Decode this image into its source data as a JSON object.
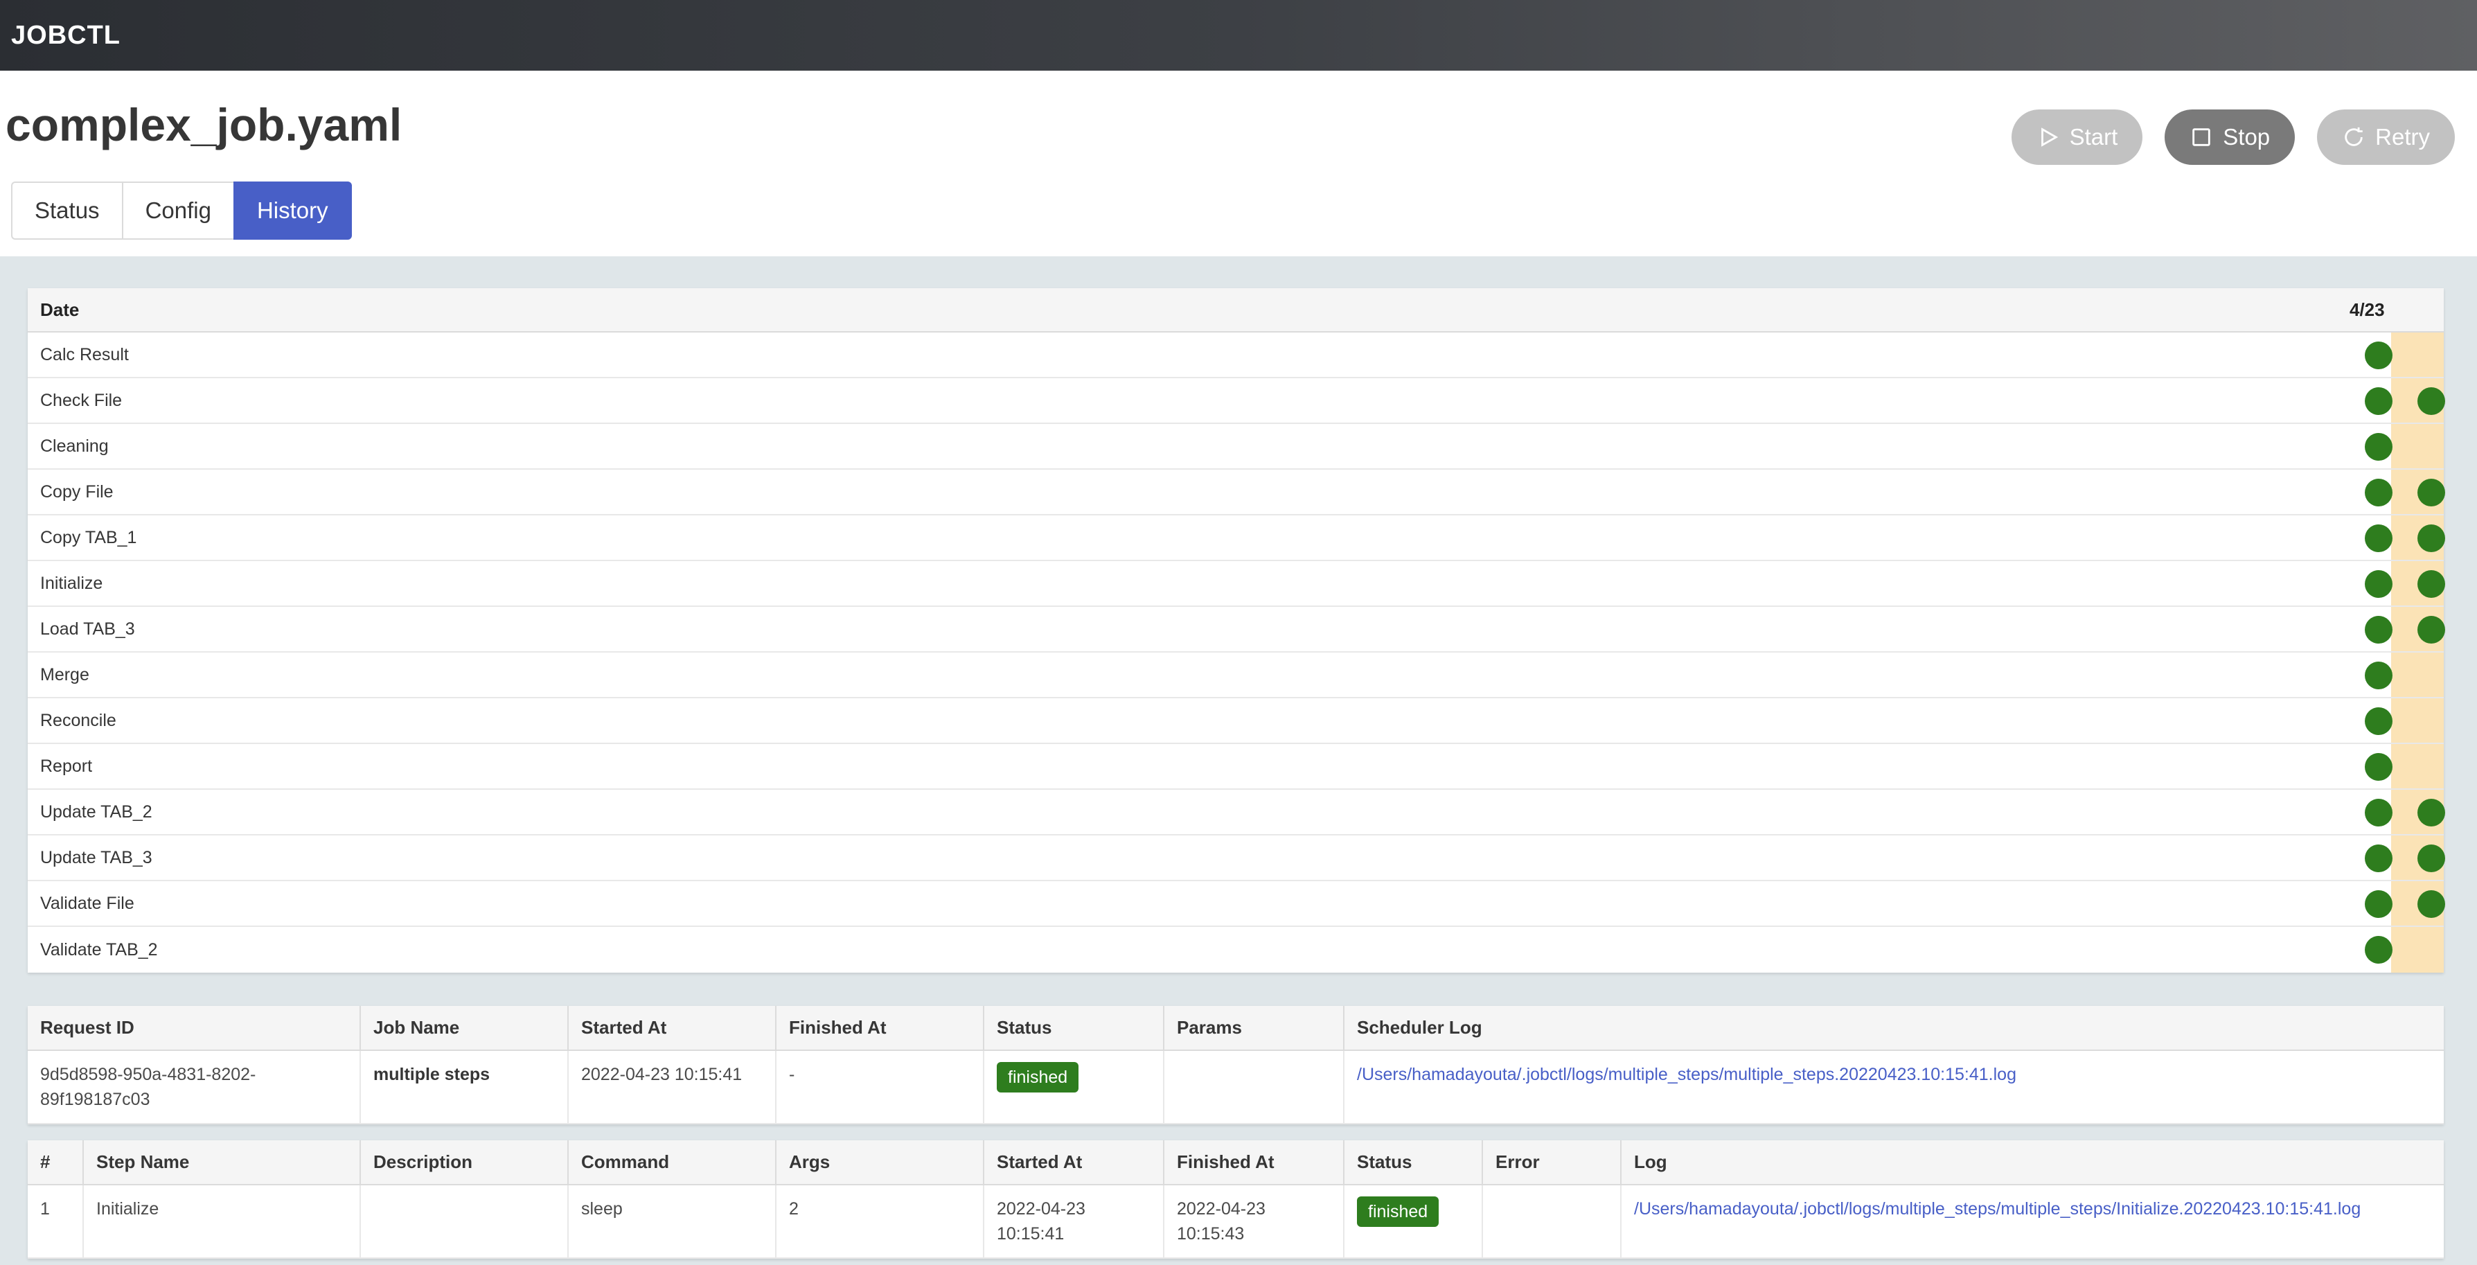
{
  "app": {
    "brand": "JOBCTL"
  },
  "header": {
    "title": "complex_job.yaml",
    "tabs": [
      {
        "label": "Status",
        "active": false
      },
      {
        "label": "Config",
        "active": false
      },
      {
        "label": "History",
        "active": true
      }
    ],
    "actions": {
      "start": "Start",
      "stop": "Stop",
      "retry": "Retry"
    }
  },
  "history_grid": {
    "date_header": "Date",
    "columns": [
      "4/23",
      ""
    ],
    "rows": [
      {
        "name": "Calc Result",
        "runs": [
          true,
          false
        ]
      },
      {
        "name": "Check File",
        "runs": [
          true,
          true
        ]
      },
      {
        "name": "Cleaning",
        "runs": [
          true,
          false
        ]
      },
      {
        "name": "Copy File",
        "runs": [
          true,
          true
        ]
      },
      {
        "name": "Copy TAB_1",
        "runs": [
          true,
          true
        ]
      },
      {
        "name": "Initialize",
        "runs": [
          true,
          true
        ]
      },
      {
        "name": "Load TAB_3",
        "runs": [
          true,
          true
        ]
      },
      {
        "name": "Merge",
        "runs": [
          true,
          false
        ]
      },
      {
        "name": "Reconcile",
        "runs": [
          true,
          false
        ]
      },
      {
        "name": "Report",
        "runs": [
          true,
          false
        ]
      },
      {
        "name": "Update TAB_2",
        "runs": [
          true,
          true
        ]
      },
      {
        "name": "Update TAB_3",
        "runs": [
          true,
          true
        ]
      },
      {
        "name": "Validate File",
        "runs": [
          true,
          true
        ]
      },
      {
        "name": "Validate TAB_2",
        "runs": [
          true,
          false
        ]
      }
    ],
    "colors": {
      "success": "#2e7d1e",
      "selected_column": "#fbe3b6"
    }
  },
  "request_table": {
    "headers": {
      "request_id": "Request ID",
      "job_name": "Job Name",
      "started_at": "Started At",
      "finished_at": "Finished At",
      "status": "Status",
      "params": "Params",
      "scheduler_log": "Scheduler Log"
    },
    "row": {
      "request_id": "9d5d8598-950a-4831-8202-89f198187c03",
      "job_name": "multiple steps",
      "started_at": "2022-04-23 10:15:41",
      "finished_at": "-",
      "status": "finished",
      "params": "",
      "scheduler_log": "/Users/hamadayouta/.jobctl/logs/multiple_steps/multiple_steps.20220423.10:15:41.log"
    }
  },
  "steps_table": {
    "headers": {
      "num": "#",
      "step_name": "Step Name",
      "description": "Description",
      "command": "Command",
      "args": "Args",
      "started_at": "Started At",
      "finished_at": "Finished At",
      "status": "Status",
      "error": "Error",
      "log": "Log"
    },
    "rows": [
      {
        "num": "1",
        "step_name": "Initialize",
        "description": "",
        "command": "sleep",
        "args": "2",
        "started_at": "2022-04-23 10:15:41",
        "finished_at": "2022-04-23 10:15:43",
        "status": "finished",
        "error": "",
        "log": "/Users/hamadayouta/.jobctl/logs/multiple_steps/multiple_steps/Initialize.20220423.10:15:41.log"
      }
    ]
  }
}
